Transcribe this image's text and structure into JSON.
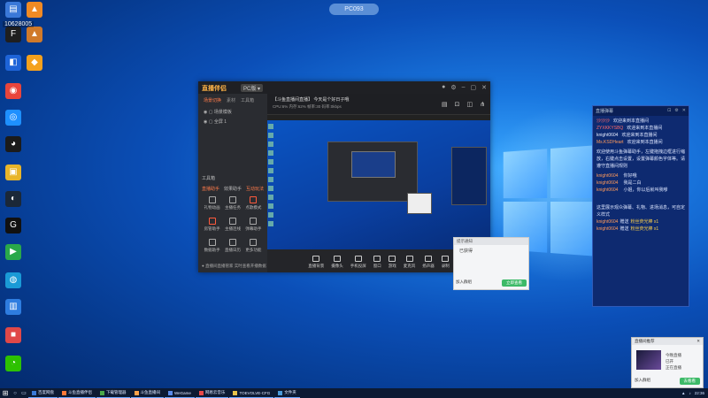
{
  "top_pill": "PC093",
  "desktop": {
    "id_badge": "10628005",
    "icons": [
      {
        "name": "blue-app-icon",
        "color": "#3a78d8",
        "glyph": "▤"
      },
      {
        "name": "orange-tent-icon",
        "color": "#f08a24",
        "glyph": "▲"
      },
      {
        "name": "fps-app-icon",
        "color": "#1f1f1f",
        "glyph": "F"
      },
      {
        "name": "tent-icon",
        "color": "#d07a2a",
        "glyph": "▲"
      },
      {
        "name": "blue-square-icon",
        "color": "#1e64d8",
        "glyph": "◧"
      },
      {
        "name": "orange-box-icon",
        "color": "#f4a11d",
        "glyph": "◆"
      },
      {
        "name": "chrome-icon",
        "color": "#e8453c",
        "glyph": "◉"
      },
      {
        "name": "blue-circle-icon",
        "color": "#1e90ff",
        "glyph": "◎"
      },
      {
        "name": "qq-icon",
        "color": "#1b1b1b",
        "glyph": "◕"
      },
      {
        "name": "yellow-app-icon",
        "color": "#e8b52a",
        "glyph": "▣"
      },
      {
        "name": "steam-icon",
        "color": "#1b2838",
        "glyph": "◐"
      },
      {
        "name": "g-app-icon",
        "color": "#111",
        "glyph": "G"
      },
      {
        "name": "green-play-icon",
        "color": "#2aa84a",
        "glyph": "▶"
      },
      {
        "name": "cyan-app-icon",
        "color": "#1a9ad6",
        "glyph": "◍"
      },
      {
        "name": "blue-doc-icon",
        "color": "#2e7de0",
        "glyph": "▥"
      },
      {
        "name": "red-app-icon",
        "color": "#e04848",
        "glyph": "■"
      },
      {
        "name": "wechat-icon",
        "color": "#2dc100",
        "glyph": "◔"
      }
    ]
  },
  "app": {
    "logo": "直播伴侣",
    "version": "PC版 ▾",
    "side_tabs": [
      "场景切换",
      "素材",
      "工具箱"
    ],
    "side_rows": [
      "◉  ▢  场景模板",
      "◉  ▢  全屏 1"
    ],
    "section": "工具箱",
    "tool_tabs": [
      "直播助手",
      "效果助手",
      "互动玩法"
    ],
    "tools": [
      {
        "label": "礼物动画",
        "hot": false
      },
      {
        "label": "主播任务",
        "hot": false
      },
      {
        "label": "点歌模式",
        "hot": true
      },
      {
        "label": "房管助手",
        "hot": true
      },
      {
        "label": "主播连线",
        "hot": false
      },
      {
        "label": "弹幕助手",
        "hot": false
      },
      {
        "label": "数据助手",
        "hot": false
      },
      {
        "label": "直播日历",
        "hot": false
      },
      {
        "label": "更多功能",
        "hot": false
      }
    ],
    "bottom_note": "● 直播间直播管家 实时查看开播数据",
    "stream_title": "【斗鱼直播间直播】 今天是个好日子哦",
    "stream_meta": "CPU:6%   内存:62%   帧率:30   码率:0kbps",
    "controls": [
      "直播背景",
      "摄像头",
      "手机投屏",
      "窗口",
      "游戏",
      "麦克风",
      "扬声器",
      "录制"
    ],
    "start_live": "开始直播"
  },
  "popup": {
    "title": "提示通知",
    "body": "已获得",
    "left_btn": "加入群组",
    "right_btn": "立即查看"
  },
  "chat": {
    "title": "直播弹幕",
    "lines": [
      {
        "user": "沙沙沙",
        "user_color": "red",
        "text": "欢迎来到本直播间"
      },
      {
        "user": "ZYXKKYSBQ",
        "user_color": "red",
        "text": "欢迎来到本直播间"
      },
      {
        "user": "knight0604",
        "user_color": "white",
        "text": "欢迎来到本直播间"
      },
      {
        "user": "Ms.KSDHeart",
        "user_color": "orange",
        "text": "欢迎来到本直播间"
      }
    ],
    "system": "欢迎使用斗鱼弹幕助手，左键拖拽边框进行缩放，右键点击设置，设置弹幕颜色字体等。请遵守直播间规则",
    "chats": [
      {
        "user": "knight0604",
        "text": "你好哦"
      },
      {
        "user": "knight0604",
        "text": "我是二白"
      },
      {
        "user": "knight0604",
        "text": "小姐，你以后就叫我嗲"
      }
    ],
    "notice": "这里展示观众弹幕、礼物、进场消息，可自定义样式",
    "gifts": [
      {
        "user": "knight0604",
        "action": "赠送",
        "item": "粉丝荧光棒 x1"
      },
      {
        "user": "knight0604",
        "action": "赠送",
        "item": "粉丝荧光棒 x1"
      }
    ]
  },
  "card": {
    "head": "直播间推荐",
    "line1": "今晚直播",
    "line2": "已开",
    "line3": "正在直播",
    "left_btn": "加入群组",
    "right_btn": "去看看"
  },
  "taskbar": {
    "items": [
      {
        "label": "百度网盘",
        "color": "#3a7ad8"
      },
      {
        "label": "斗鱼直播伴侣",
        "color": "#ff7a3a"
      },
      {
        "label": "下载管理器",
        "color": "#4aa84a"
      },
      {
        "label": "斗鱼直播间",
        "color": "#ffa24a"
      },
      {
        "label": "WeGame",
        "color": "#5a8ae8"
      },
      {
        "label": "网易云音乐",
        "color": "#e84848"
      },
      {
        "label": "TOEVOLVE-CFG",
        "color": "#e8c24a"
      },
      {
        "label": "文件夹",
        "color": "#4a9ad8"
      }
    ],
    "time": "22:36"
  }
}
